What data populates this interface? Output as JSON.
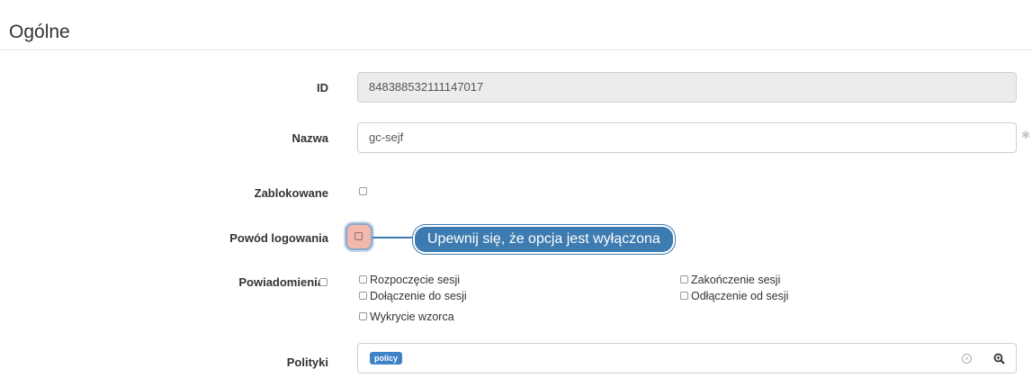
{
  "section": {
    "title": "Ogólne"
  },
  "fields": {
    "id": {
      "label": "ID",
      "value": "848388532111147017"
    },
    "name": {
      "label": "Nazwa",
      "value": "gc-sejf",
      "required_mark": "✱"
    },
    "blocked": {
      "label": "Zablokowane",
      "checked": false
    },
    "login_reason": {
      "label": "Powód logowania",
      "checked": false
    },
    "notifications": {
      "label": "Powiadomienia",
      "options": [
        "Rozpoczęcie sesji",
        "Zakończenie sesji",
        "Dołączenie do sesji",
        "Odłączenie od sesji",
        "Wykrycie wzorca"
      ]
    },
    "policies": {
      "label": "Polityki",
      "tags": [
        "policy"
      ]
    }
  },
  "callout": {
    "text": "Upewnij się, że opcja jest wyłączona"
  },
  "colors": {
    "callout_bg": "#3d7bb0",
    "tag_bg": "#3e83c9",
    "highlight": "#f2b8ae"
  }
}
